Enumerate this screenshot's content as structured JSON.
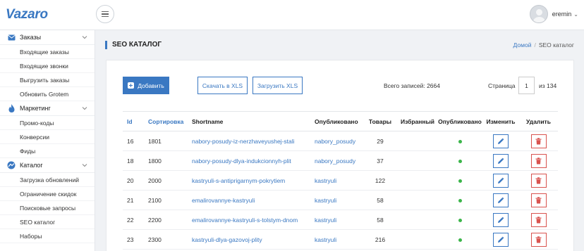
{
  "app": {
    "logo": "Vazaro"
  },
  "user": {
    "name": "eremin"
  },
  "sidebar": {
    "sections": [
      {
        "label": "Заказы",
        "icon": "envelope-icon",
        "items": [
          "Входящие заказы",
          "Входящие звонки",
          "Выгрузить заказы",
          "Обновить Grotem"
        ]
      },
      {
        "label": "Маркетинг",
        "icon": "flame-icon",
        "items": [
          "Промо-коды",
          "Конверсии",
          "Фиды"
        ]
      },
      {
        "label": "Каталог",
        "icon": "catalog-icon",
        "items": [
          "Загрузка обновлений",
          "Ограничение скидок",
          "Поисковые запросы",
          "SEO каталог",
          "Наборы"
        ]
      }
    ]
  },
  "page": {
    "title": "SEO КАТАЛОГ",
    "breadcrumb": {
      "home": "Домой",
      "sep": "/",
      "current": "SEO каталог"
    }
  },
  "toolbar": {
    "add_label": "Добавить",
    "download_label": "Скачать в XLS",
    "upload_label": "Загрузить XLS",
    "total_label": "Всего записей: 2664",
    "page_label": "Страница",
    "page_value": "1",
    "page_of": "из 134"
  },
  "table": {
    "headers": [
      "Id",
      "Сортировка",
      "Shortname",
      "Опубликовано",
      "Товары",
      "Избранный",
      "Опубликовано",
      "Изменить",
      "Удалить"
    ],
    "rows": [
      {
        "id": "16",
        "sort": "1801",
        "shortname": "nabory-posudy-iz-nerzhaveyushej-stali",
        "published": "nabory_posudy",
        "goods": "29"
      },
      {
        "id": "18",
        "sort": "1800",
        "shortname": "nabory-posudy-dlya-indukcionnyh-plit",
        "published": "nabory_posudy",
        "goods": "37"
      },
      {
        "id": "20",
        "sort": "2000",
        "shortname": "kastryuli-s-antiprigarnym-pokrytiem",
        "published": "kastryuli",
        "goods": "122"
      },
      {
        "id": "21",
        "sort": "2100",
        "shortname": "emalirovannye-kastryuli",
        "published": "kastryuli",
        "goods": "58"
      },
      {
        "id": "22",
        "sort": "2200",
        "shortname": "emalirovannye-kastryuli-s-tolstym-dnom",
        "published": "kastryuli",
        "goods": "58"
      },
      {
        "id": "23",
        "sort": "2300",
        "shortname": "kastryuli-dlya-gazovoj-plity",
        "published": "kastryuli",
        "goods": "216"
      }
    ]
  },
  "colors": {
    "accent": "#3a78c2",
    "published_dot": "#3bb54a",
    "delete": "#d9534f"
  }
}
